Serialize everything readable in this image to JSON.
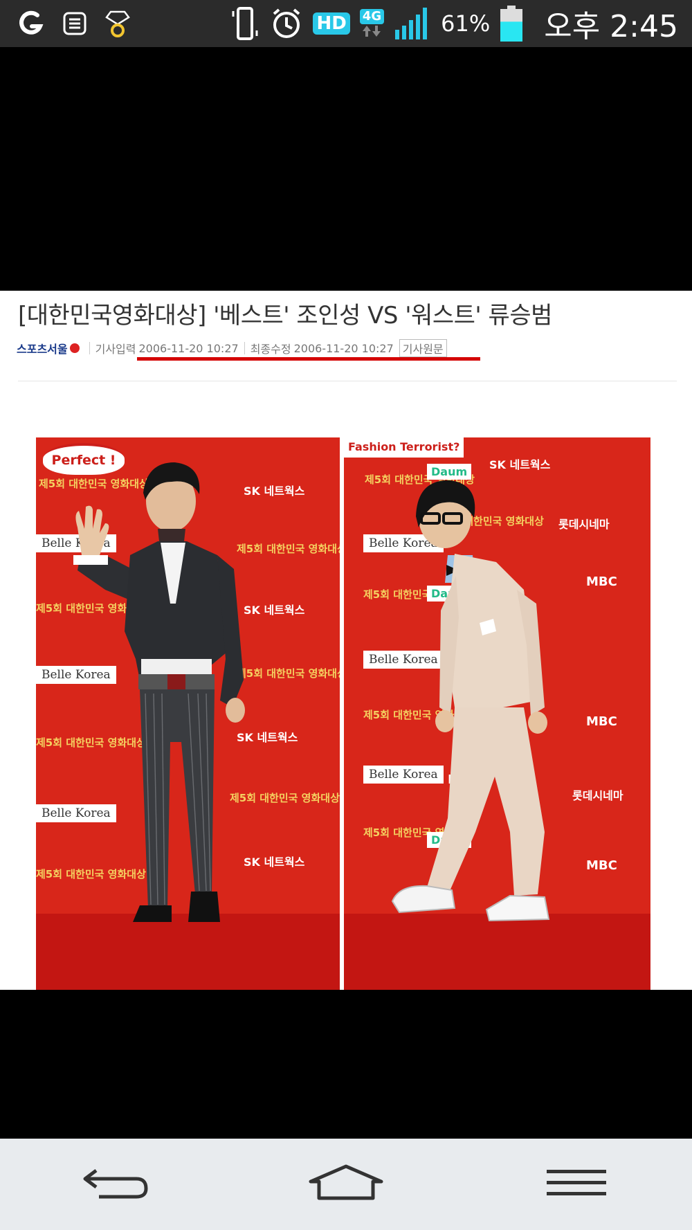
{
  "status_bar": {
    "left_icons": [
      "carrier-logo-icon",
      "notes-icon",
      "gem-ring-icon"
    ],
    "right_icons": [
      "vibrate-icon",
      "alarm-icon",
      "hd-badge-icon",
      "4g-data-icon",
      "signal-icon",
      "battery-icon"
    ],
    "hd_label": "HD",
    "network_label": "4G",
    "battery_percent": "61%",
    "battery_level": 0.61,
    "time": "오후 2:45",
    "accent": "#29c8e8"
  },
  "article": {
    "headline": "[대한민국영화대상] '베스트' 조인성 VS '워스트' 류승범",
    "source": "스포츠서울",
    "input_label": "기사입력",
    "input_date": "2006-11-20 10:27",
    "modified_label": "최종수정",
    "modified_date": "2006-11-20 10:27",
    "original_link": "기사원문",
    "underline_color": "#d40000"
  },
  "photos": {
    "left_caption": "Perfect !",
    "right_caption": "Fashion Terrorist?",
    "backdrop_texts": {
      "award": "제5회 대한민국 영화대상",
      "belle": "Belle Korea",
      "sk": "SK 네트웍스",
      "mbc": "MBC",
      "daum": "Daum",
      "lotte": "롯데시네마"
    }
  },
  "nav_bar": {
    "buttons": [
      "back-icon",
      "home-icon",
      "menu-icon"
    ]
  }
}
